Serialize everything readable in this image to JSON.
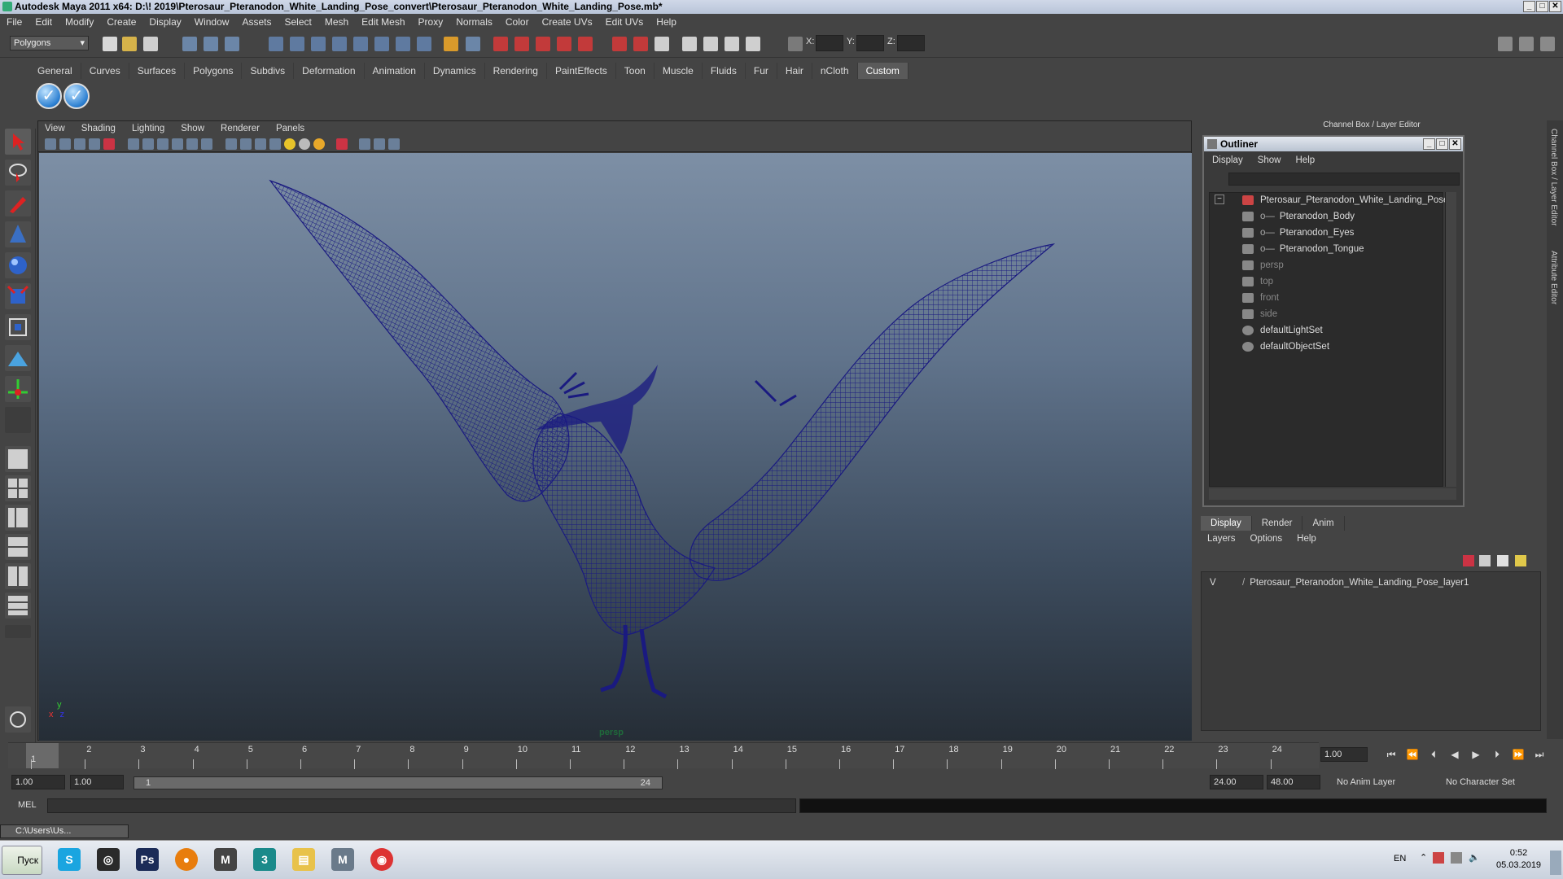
{
  "window": {
    "title": "Autodesk Maya 2011 x64: D:\\! 2019\\Pterosaur_Pteranodon_White_Landing_Pose_convert\\Pterosaur_Pteranodon_White_Landing_Pose.mb*"
  },
  "menu": [
    "File",
    "Edit",
    "Modify",
    "Create",
    "Display",
    "Window",
    "Assets",
    "Select",
    "Mesh",
    "Edit Mesh",
    "Proxy",
    "Normals",
    "Color",
    "Create UVs",
    "Edit UVs",
    "Help"
  ],
  "status": {
    "mode": "Polygons",
    "x_label": "X:",
    "y_label": "Y:",
    "z_label": "Z:"
  },
  "shelf": {
    "tabs": [
      "General",
      "Curves",
      "Surfaces",
      "Polygons",
      "Subdivs",
      "Deformation",
      "Animation",
      "Dynamics",
      "Rendering",
      "PaintEffects",
      "Toon",
      "Muscle",
      "Fluids",
      "Fur",
      "Hair",
      "nCloth",
      "Custom"
    ],
    "active_tab": "Custom"
  },
  "viewport": {
    "menu": [
      "View",
      "Shading",
      "Lighting",
      "Show",
      "Renderer",
      "Panels"
    ],
    "camera": "persp",
    "axis_y": "y",
    "axis_x": "x",
    "axis_z": "z",
    "wire_color": "#1a1a80"
  },
  "channelbox": {
    "title": "Channel Box / Layer Editor"
  },
  "outliner": {
    "title": "Outliner",
    "menu": [
      "Display",
      "Show",
      "Help"
    ],
    "items": [
      {
        "label": "Pterosaur_Pteranodon_White_Landing_Pose",
        "type": "group"
      },
      {
        "label": "Pteranodon_Body",
        "type": "mesh"
      },
      {
        "label": "Pteranodon_Eyes",
        "type": "mesh"
      },
      {
        "label": "Pteranodon_Tongue",
        "type": "mesh"
      },
      {
        "label": "persp",
        "type": "camera"
      },
      {
        "label": "top",
        "type": "camera"
      },
      {
        "label": "front",
        "type": "camera"
      },
      {
        "label": "side",
        "type": "camera"
      },
      {
        "label": "defaultLightSet",
        "type": "set"
      },
      {
        "label": "defaultObjectSet",
        "type": "set"
      }
    ]
  },
  "layer_editor": {
    "tabs": [
      "Display",
      "Render",
      "Anim"
    ],
    "active_tab": "Display",
    "menu": [
      "Layers",
      "Options",
      "Help"
    ],
    "layers": [
      {
        "v": "V",
        "name": "Pterosaur_Pteranodon_White_Landing_Pose_layer1"
      }
    ]
  },
  "side_tabs": [
    "Channel Box / Layer Editor",
    "Attribute Editor"
  ],
  "timeline": {
    "frames": [
      "1",
      "2",
      "3",
      "4",
      "5",
      "6",
      "7",
      "8",
      "9",
      "10",
      "11",
      "12",
      "13",
      "14",
      "15",
      "16",
      "17",
      "18",
      "19",
      "20",
      "21",
      "22",
      "23",
      "24"
    ],
    "current_frame": "1.00",
    "current_marker": "1"
  },
  "range": {
    "start": "1.00",
    "anim_start": "1.00",
    "bar_start": "1",
    "bar_end": "24",
    "anim_end": "24.00",
    "end": "48.00",
    "anim_layer": "No Anim Layer",
    "char_set": "No Character Set"
  },
  "cmd": {
    "label": "MEL"
  },
  "minimized": {
    "label": "C:\\Users\\Us..."
  },
  "taskbar": {
    "start": "Пуск",
    "apps": [
      "Skype",
      "Steam",
      "Photoshop",
      "Blender",
      "Maya",
      "Max",
      "Explorer",
      "Maya2",
      "Chrome"
    ],
    "lang": "EN",
    "time": "0:52",
    "date": "05.03.2019"
  }
}
